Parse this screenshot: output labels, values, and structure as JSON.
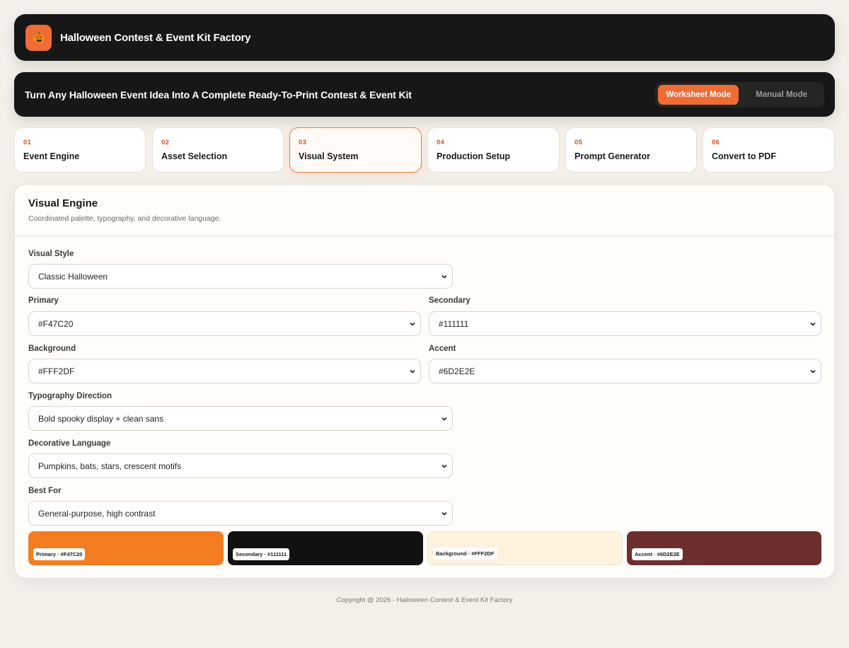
{
  "app": {
    "title": "Halloween Contest & Event Kit Factory",
    "logo_icon": "pumpkin-icon",
    "logo_color": "#EF6C35"
  },
  "banner": {
    "text": "Turn Any Halloween Event Idea Into A Complete Ready-To-Print Contest & Event Kit"
  },
  "modes": {
    "worksheet": "Worksheet Mode",
    "manual": "Manual Mode",
    "active": "Worksheet Mode"
  },
  "steps": [
    {
      "num": "01",
      "label": "Event Engine"
    },
    {
      "num": "02",
      "label": "Asset Selection"
    },
    {
      "num": "03",
      "label": "Visual System",
      "active": true
    },
    {
      "num": "04",
      "label": "Production Setup"
    },
    {
      "num": "05",
      "label": "Prompt Generator"
    },
    {
      "num": "06",
      "label": "Convert to PDF"
    }
  ],
  "panel": {
    "title": "Visual Engine",
    "subtitle": "Coordinated palette, typography, and decorative language.",
    "fields": {
      "visual_style": {
        "label": "Visual Style",
        "value": "Classic Halloween"
      },
      "primary": {
        "label": "Primary",
        "value": "#F47C20"
      },
      "secondary": {
        "label": "Secondary",
        "value": "#111111"
      },
      "background": {
        "label": "Background",
        "value": "#FFF2DF"
      },
      "accent": {
        "label": "Accent",
        "value": "#6D2E2E"
      },
      "typography": {
        "label": "Typography Direction",
        "value": "Bold spooky display + clean sans"
      },
      "decorative": {
        "label": "Decorative Language",
        "value": "Pumpkins, bats, stars, crescent motifs"
      },
      "best_for": {
        "label": "Best For",
        "value": "General-purpose, high contrast"
      }
    },
    "swatches": [
      {
        "label": "Primary · #F47C20",
        "color": "#F47C20"
      },
      {
        "label": "Secondary · #111111",
        "color": "#111111"
      },
      {
        "label": "Background · #FFF2DF",
        "color": "#FFF2DF"
      },
      {
        "label": "Accent · #6D2E2E",
        "color": "#6D2E2E"
      }
    ]
  },
  "footer": {
    "text": "Copyright @ 2026 - Halloween Contest & Event Kit Factory"
  }
}
